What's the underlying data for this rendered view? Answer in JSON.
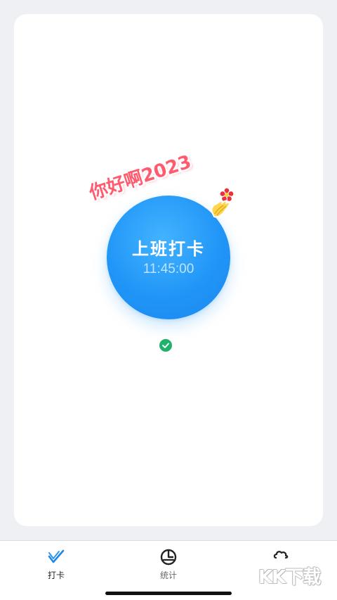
{
  "punch": {
    "label": "上班打卡",
    "time": "11:45:00"
  },
  "sticker": {
    "text": "你好啊2023",
    "color": "#ff5a6e"
  },
  "status": {
    "icon": "check-circle-icon",
    "color": "#1fb26b"
  },
  "tabs": [
    {
      "label": "打卡",
      "icon": "check-mark-icon",
      "active": true,
      "color": "#1e88e5"
    },
    {
      "label": "统计",
      "icon": "pie-chart-icon",
      "active": false,
      "color": "#222222"
    },
    {
      "label": "",
      "icon": "cloud-gear-icon",
      "active": false,
      "color": "#222222"
    }
  ],
  "watermark": {
    "text": "KK下载"
  },
  "colors": {
    "accent": "#2196f7",
    "background": "#eef0f3",
    "card": "#ffffff"
  }
}
